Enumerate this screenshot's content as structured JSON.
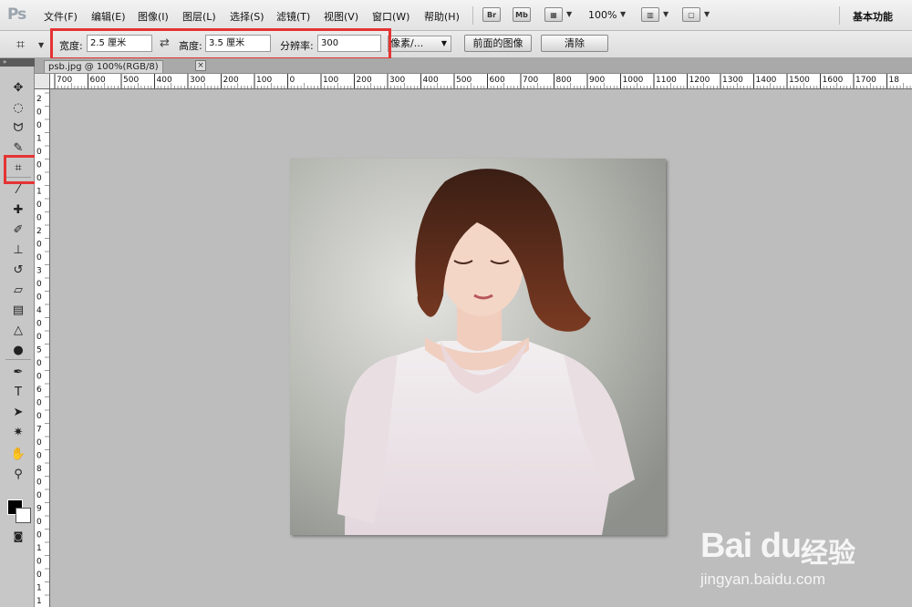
{
  "app": {
    "logo": "Ps"
  },
  "menu": {
    "items": [
      "文件(F)",
      "编辑(E)",
      "图像(I)",
      "图层(L)",
      "选择(S)",
      "滤镜(T)",
      "视图(V)",
      "窗口(W)",
      "帮助(H)"
    ],
    "bridge_label": "Br",
    "minibridge_label": "Mb",
    "zoom": "100%",
    "workspace": "基本功能"
  },
  "options": {
    "width_label": "宽度:",
    "width_value": "2.5 厘米",
    "height_label": "高度:",
    "height_value": "3.5 厘米",
    "resolution_label": "分辨率:",
    "resolution_value": "300",
    "resolution_unit": "像素/...",
    "front_image_button": "前面的图像",
    "clear_button": "清除"
  },
  "document": {
    "tab_title": "psb.jpg @ 100%(RGB/8)",
    "close_glyph": "×"
  },
  "ruler": {
    "h_labels": [
      "700",
      "600",
      "500",
      "400",
      "300",
      "200",
      "100",
      "0",
      "100",
      "200",
      "300",
      "400",
      "500",
      "600",
      "700",
      "800",
      "900",
      "1000",
      "1100",
      "1200",
      "1300",
      "1400",
      "1500",
      "1600",
      "1700",
      "18"
    ],
    "v_labels": [
      "2",
      "0",
      "0",
      "1",
      "0",
      "0",
      "0",
      "1",
      "0",
      "0",
      "2",
      "0",
      "0",
      "3",
      "0",
      "0",
      "4",
      "0",
      "0",
      "5",
      "0",
      "0",
      "6",
      "0",
      "0",
      "7",
      "0",
      "0",
      "8",
      "0",
      "0",
      "9",
      "0",
      "0",
      "1",
      "0",
      "0",
      "1",
      "1"
    ]
  },
  "toolbox": {
    "tools": [
      {
        "name": "move-tool-icon",
        "glyph": "✥"
      },
      {
        "name": "marquee-tool-icon",
        "glyph": "◌"
      },
      {
        "name": "lasso-tool-icon",
        "glyph": "ᗢ"
      },
      {
        "name": "quick-select-tool-icon",
        "glyph": "✎"
      },
      {
        "name": "crop-tool-icon",
        "glyph": "⌗"
      },
      {
        "name": "eyedropper-tool-icon",
        "glyph": "⁄"
      },
      {
        "name": "healing-brush-tool-icon",
        "glyph": "✚"
      },
      {
        "name": "brush-tool-icon",
        "glyph": "✐"
      },
      {
        "name": "clone-stamp-tool-icon",
        "glyph": "⊥"
      },
      {
        "name": "history-brush-tool-icon",
        "glyph": "↺"
      },
      {
        "name": "eraser-tool-icon",
        "glyph": "▱"
      },
      {
        "name": "gradient-tool-icon",
        "glyph": "▤"
      },
      {
        "name": "blur-tool-icon",
        "glyph": "△"
      },
      {
        "name": "dodge-tool-icon",
        "glyph": "●"
      },
      {
        "name": "pen-tool-icon",
        "glyph": "✒"
      },
      {
        "name": "type-tool-icon",
        "glyph": "T"
      },
      {
        "name": "path-select-tool-icon",
        "glyph": "➤"
      },
      {
        "name": "shape-tool-icon",
        "glyph": "✷"
      },
      {
        "name": "hand-tool-icon",
        "glyph": "✋"
      },
      {
        "name": "zoom-tool-icon",
        "glyph": "⚲"
      }
    ]
  },
  "watermark": {
    "brand": "Bai du",
    "sub": "经验",
    "url": "jingyan.baidu.com"
  },
  "colors": {
    "highlight": "#e53333",
    "canvas_bg": "#bdbdbd"
  }
}
